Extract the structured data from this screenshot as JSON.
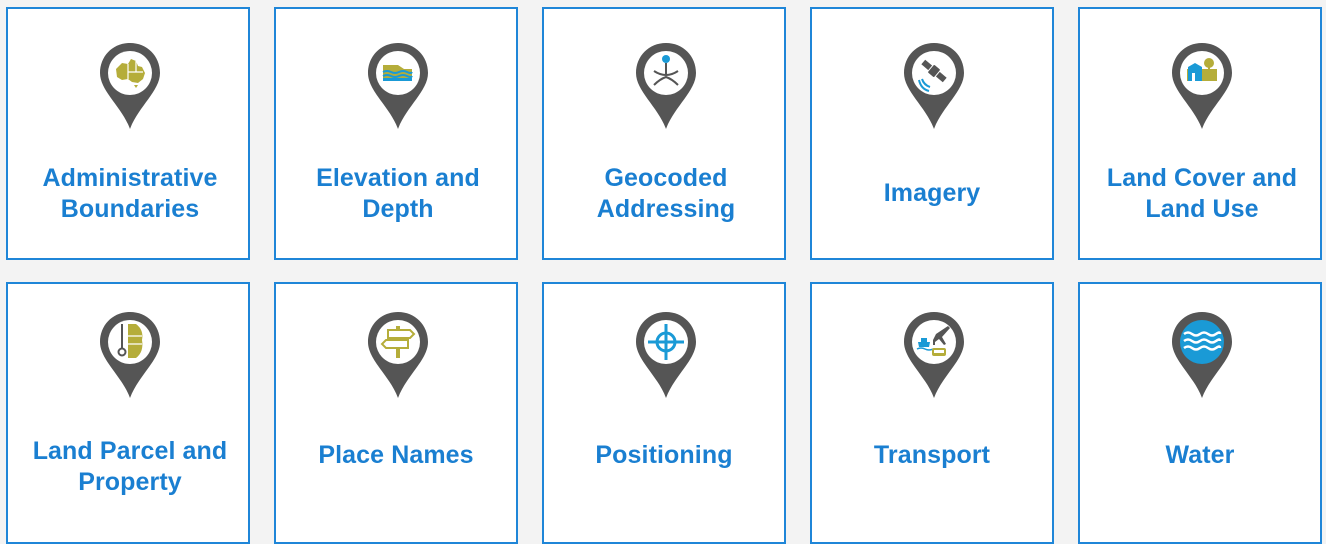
{
  "tiles": [
    {
      "label": "Administrative Boundaries",
      "icon": "australia-map-icon"
    },
    {
      "label": "Elevation and Depth",
      "icon": "elevation-depth-icon"
    },
    {
      "label": "Geocoded Addressing",
      "icon": "geocoded-address-icon"
    },
    {
      "label": "Imagery",
      "icon": "satellite-icon"
    },
    {
      "label": "Land Cover and Land Use",
      "icon": "land-cover-icon"
    },
    {
      "label": "Land Parcel and Property",
      "icon": "land-parcel-icon"
    },
    {
      "label": "Place Names",
      "icon": "signpost-icon"
    },
    {
      "label": "Positioning",
      "icon": "crosshair-icon"
    },
    {
      "label": "Transport",
      "icon": "transport-icon"
    },
    {
      "label": "Water",
      "icon": "water-waves-icon"
    }
  ],
  "colors": {
    "accent": "#1a7fd1",
    "border": "#1f86d8",
    "pin": "#555555",
    "olive": "#b5ad3a",
    "blue": "#1a9ad6",
    "background": "#f3f3f3"
  }
}
